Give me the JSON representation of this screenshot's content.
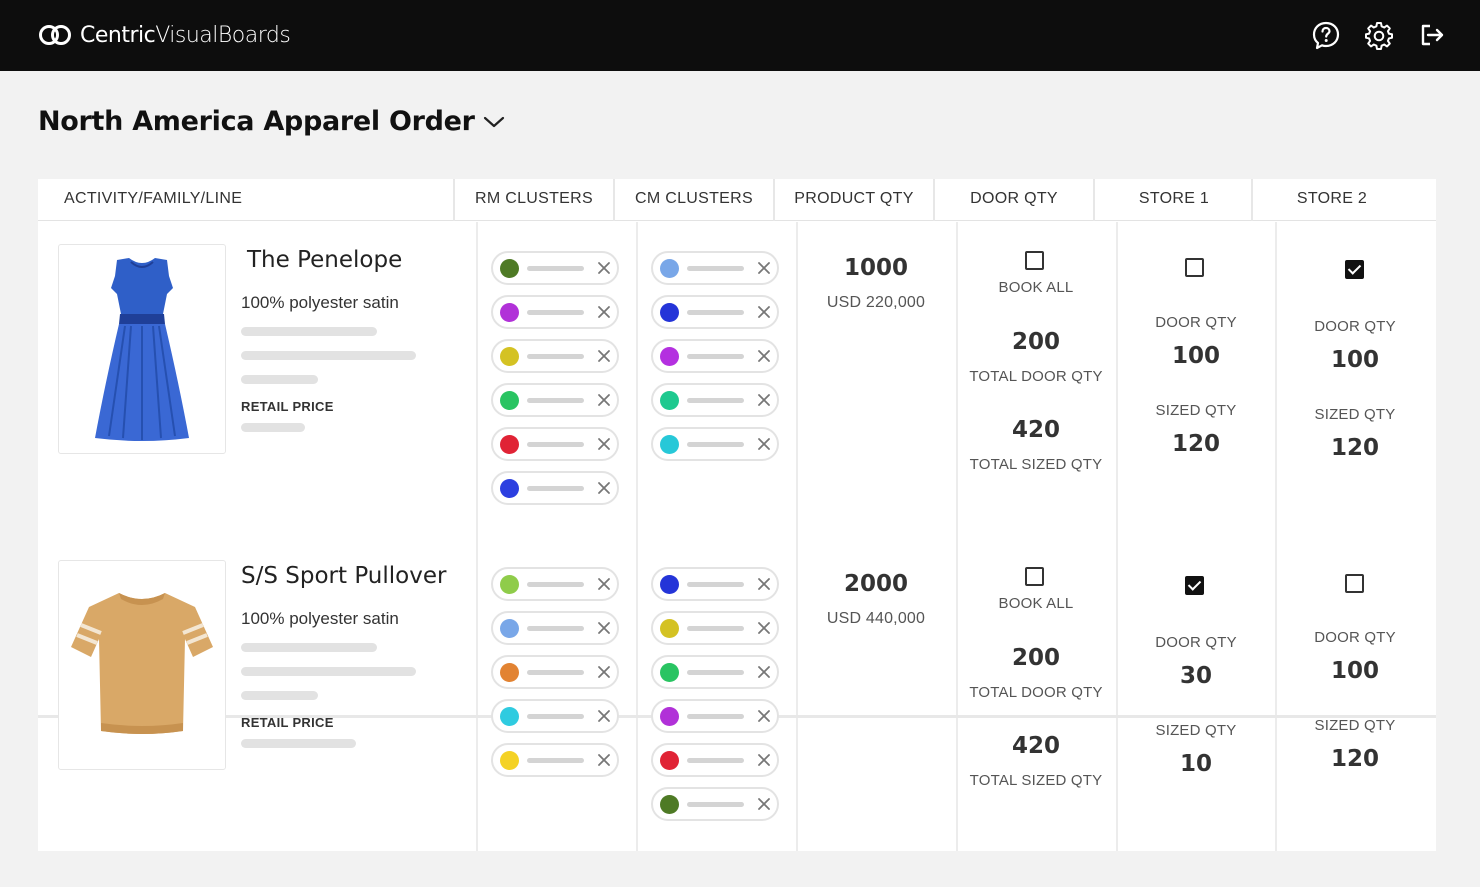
{
  "app": {
    "brand_a": "Centric",
    "brand_b": "VisualBoards"
  },
  "header_icons": [
    "help-icon",
    "gear-icon",
    "logout-icon"
  ],
  "page": {
    "title": "North America Apparel Order"
  },
  "columns": [
    "ACTIVITY/FAMILY/LINE",
    "RM CLUSTERS",
    "CM CLUSTERS",
    "PRODUCT QTY",
    "DOOR QTY",
    "STORE 1",
    "STORE 2"
  ],
  "products": [
    {
      "name": "The Penelope",
      "description": "100% polyester satin",
      "retail_label": "RETAIL PRICE",
      "rm_clusters": [
        "#4e7a25",
        "#b131d8",
        "#d4c223",
        "#29c462",
        "#e02335",
        "#2c3fe0"
      ],
      "cm_clusters": [
        "#79a7e8",
        "#2434d8",
        "#b430e0",
        "#1ec98f",
        "#27c8d8"
      ],
      "product_qty": "1000",
      "product_value": "USD 220,000",
      "book_all_label": "BOOK ALL",
      "book_all_checked": false,
      "total_door_qty": "200",
      "total_door_qty_label": "TOTAL DOOR QTY",
      "total_sized_qty": "420",
      "total_sized_qty_label": "TOTAL SIZED QTY",
      "stores": [
        {
          "checked": false,
          "door_label": "DOOR QTY",
          "door_qty": "100",
          "sized_label": "SIZED QTY",
          "sized_qty": "120"
        },
        {
          "checked": true,
          "door_label": "DOOR QTY",
          "door_qty": "100",
          "sized_label": "SIZED QTY",
          "sized_qty": "120"
        }
      ]
    },
    {
      "name": "S/S Sport Pullover",
      "description": "100% polyester satin",
      "retail_label": "RETAIL PRICE",
      "rm_clusters": [
        "#8fcc4a",
        "#79a7e8",
        "#e28332",
        "#2fcbe0",
        "#f4d225"
      ],
      "cm_clusters": [
        "#2434d8",
        "#d4c223",
        "#29c462",
        "#b131d8",
        "#e02335",
        "#4e7a25"
      ],
      "product_qty": "2000",
      "product_value": "USD 440,000",
      "book_all_label": "BOOK ALL",
      "book_all_checked": false,
      "total_door_qty": "200",
      "total_door_qty_label": "TOTAL DOOR QTY",
      "total_sized_qty": "420",
      "total_sized_qty_label": "TOTAL SIZED QTY",
      "stores": [
        {
          "checked": true,
          "door_label": "DOOR QTY",
          "door_qty": "30",
          "sized_label": "SIZED QTY",
          "sized_qty": "10"
        },
        {
          "checked": false,
          "door_label": "DOOR QTY",
          "door_qty": "100",
          "sized_label": "SIZED QTY",
          "sized_qty": "120"
        }
      ]
    }
  ]
}
